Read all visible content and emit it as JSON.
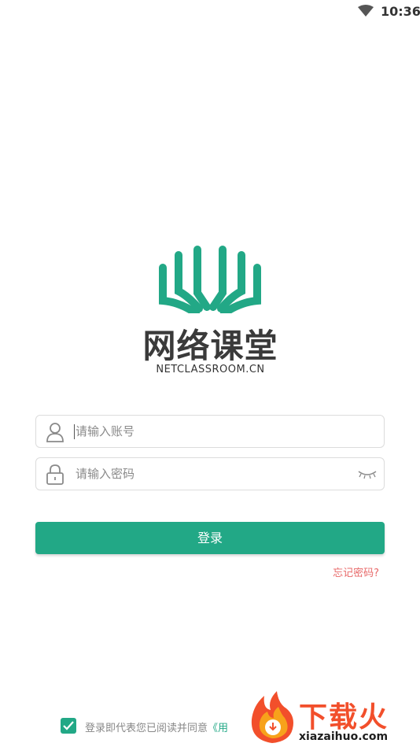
{
  "status_bar": {
    "time": "10:36"
  },
  "logo": {
    "title": "网络课堂",
    "subtitle": "NETCLASSROOM.CN"
  },
  "login_form": {
    "account_placeholder": "请输入账号",
    "password_placeholder": "请输入密码",
    "submit_label": "登录",
    "forgot_password": "忘记密码?"
  },
  "agreement": {
    "text": "登录即代表您已阅读并同意",
    "link": "《用"
  },
  "watermark": {
    "title": "下载火",
    "url": "xiazaihuo.com"
  },
  "colors": {
    "accent": "#22a886",
    "link_red": "#e86a6a",
    "watermark_red": "#f24f2b"
  }
}
